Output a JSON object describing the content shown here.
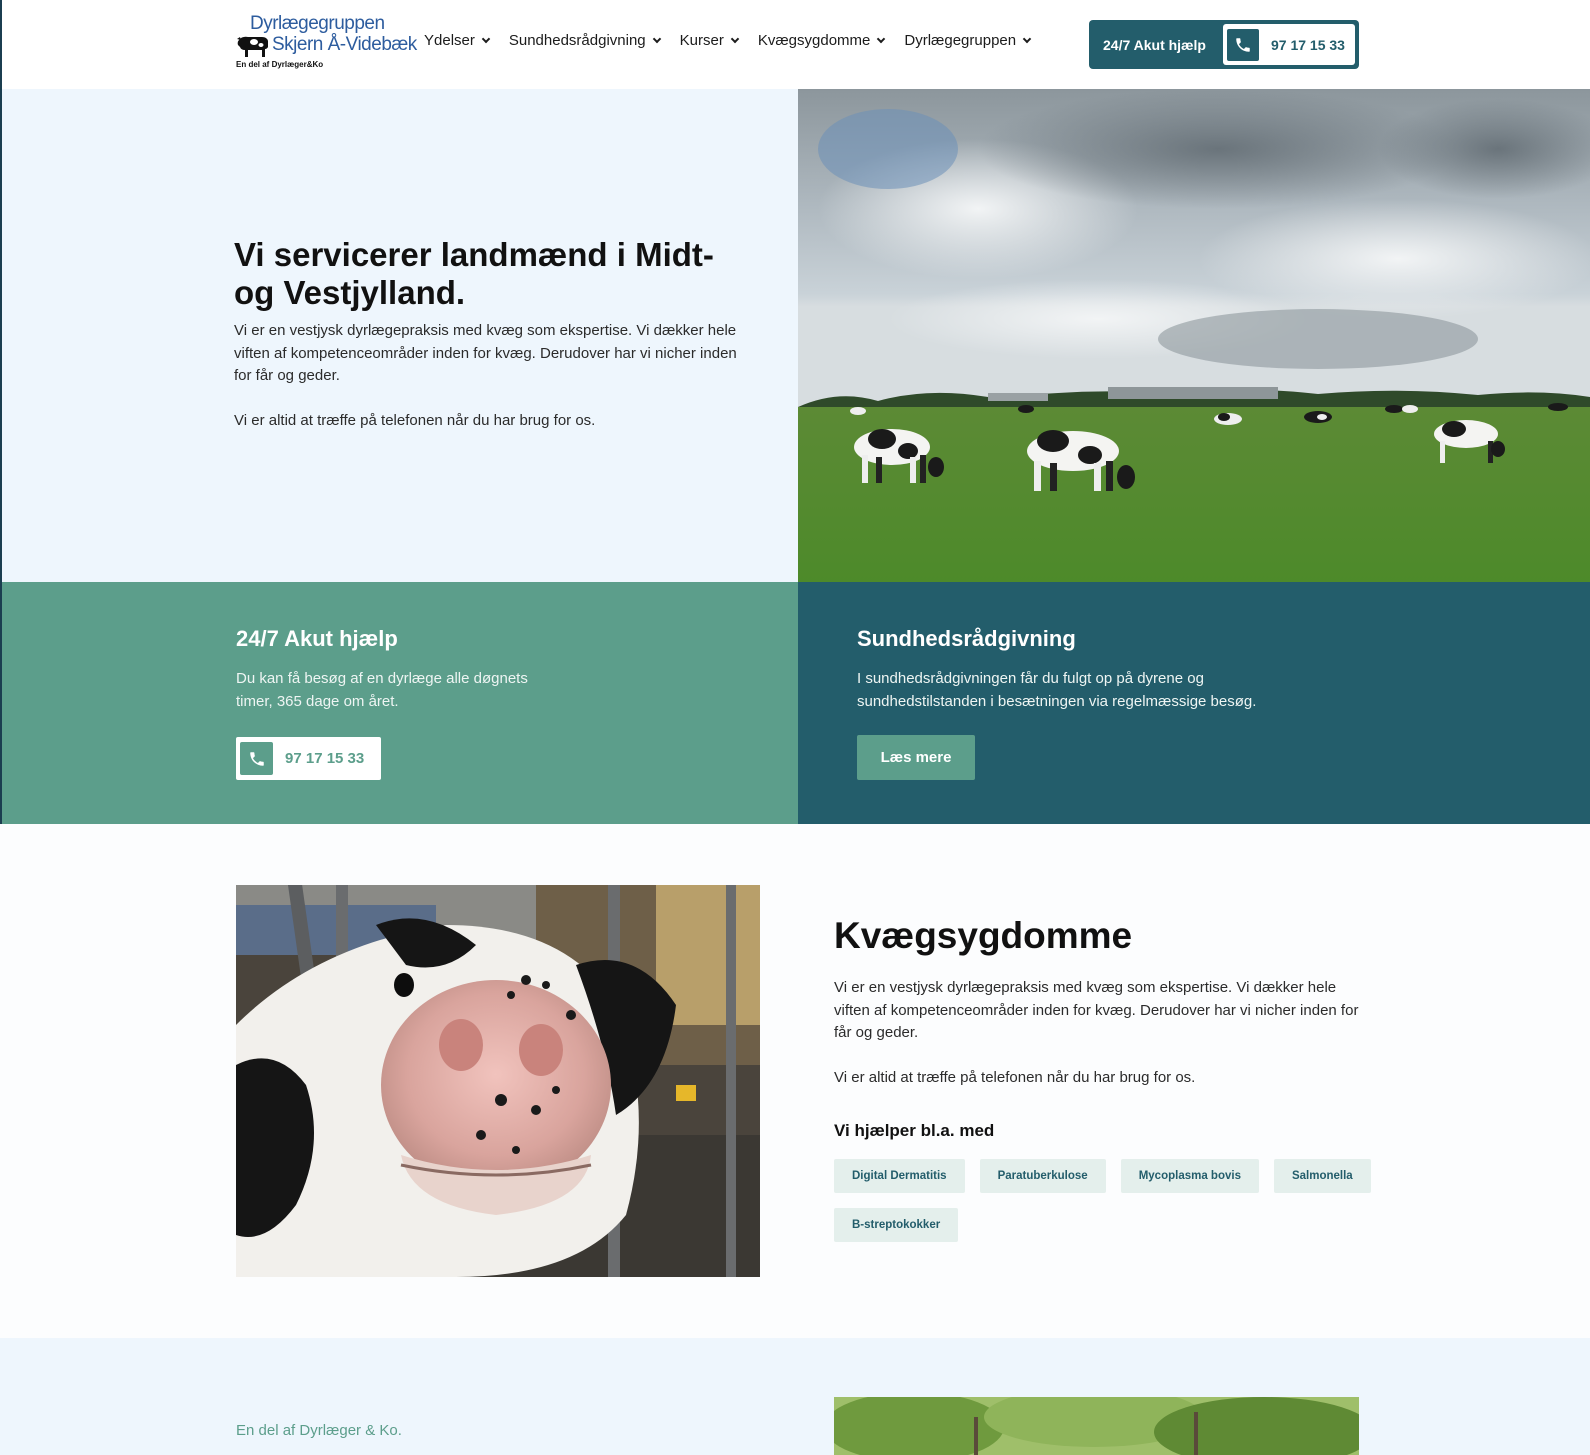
{
  "header": {
    "logo": {
      "line1": "Dyrlægegruppen",
      "line2": "Skjern Å-Videbæk",
      "subline": "En del af Dyrlæger&Ko"
    },
    "nav": [
      {
        "label": "Ydelser"
      },
      {
        "label": "Sundhedsrådgivning"
      },
      {
        "label": "Kurser"
      },
      {
        "label": "Kvægsygdomme"
      },
      {
        "label": "Dyrlægegruppen"
      }
    ],
    "akut": {
      "label": "24/7 Akut hjælp",
      "phone": "97 17 15 33"
    }
  },
  "hero": {
    "title": "Vi servicerer landmænd i Midt- og Vestjylland.",
    "paragraph1": "Vi er en vestjysk dyrlægepraksis med kvæg som ekspertise. Vi dækker hele viften af kompetenceområder inden for kvæg. Derudover har vi nicher inden for får og geder.",
    "paragraph2": "Vi er altid at træffe på telefonen når du har brug for os."
  },
  "features": {
    "akut": {
      "title": "24/7 Akut hjælp",
      "text": "Du kan få besøg af en dyrlæge alle døgnets timer, 365 dage om året.",
      "phone": "97 17 15 33"
    },
    "sundhed": {
      "title": "Sundhedsrådgivning",
      "text": "I sundhedsrådgivningen får du fulgt op på dyrene og sundhedstilstanden i besætningen via regelmæssige besøg.",
      "button": "Læs mere"
    }
  },
  "kvaeg": {
    "title": "Kvægsygdomme",
    "paragraph1": "Vi er en vestjysk dyrlægepraksis med kvæg som ekspertise. Vi dækker hele viften af kompetenceområder inden for kvæg. Derudover har vi nicher inden for får og geder.",
    "paragraph2": "Vi er altid at træffe på telefonen når du har brug for os.",
    "subheading": "Vi hjælper bl.a. med",
    "tags": [
      "Digital Dermatitis",
      "Paratuberkulose",
      "Mycoplasma bovis",
      "Salmonella",
      "B-streptokokker"
    ]
  },
  "bottom": {
    "kicker": "En del af Dyrlæger & Ko."
  },
  "colors": {
    "primary_dark": "#235d6b",
    "primary_green": "#5c9e8b",
    "hero_bg": "#eef6fd",
    "logo_blue": "#2d5c9e"
  },
  "icons": {
    "phone": "phone-icon",
    "chevron": "chevron-down-icon"
  }
}
